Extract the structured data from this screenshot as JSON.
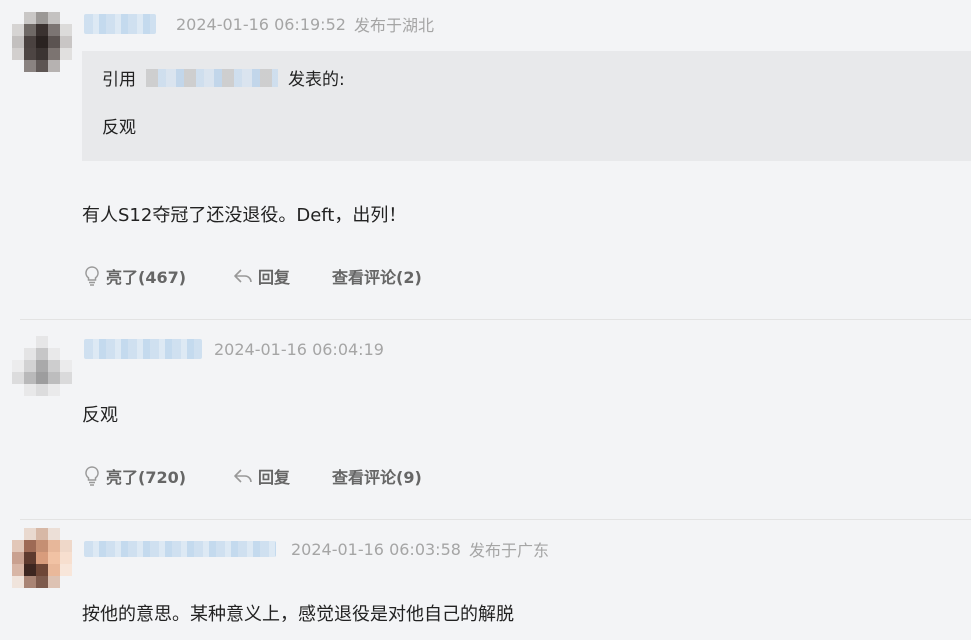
{
  "comments": [
    {
      "timestamp": "2024-01-16 06:19:52",
      "location": "发布于湖北",
      "quote": {
        "prefix": "引用",
        "suffix": "发表的:",
        "text": "反观"
      },
      "body": "有人S12夺冠了还没退役。Deft，出列！",
      "actions": {
        "like": "亮了(467)",
        "reply": "回复",
        "view": "查看评论(2)"
      }
    },
    {
      "timestamp": "2024-01-16 06:04:19",
      "location": "",
      "body": "反观",
      "actions": {
        "like": "亮了(720)",
        "reply": "回复",
        "view": "查看评论(9)"
      }
    },
    {
      "timestamp": "2024-01-16 06:03:58",
      "location": "发布于广东",
      "body": "按他的意思。某种意义上，感觉退役是对他自己的解脱"
    }
  ],
  "icons": {
    "like": "lightbulb-icon",
    "reply": "reply-arrow-icon"
  },
  "colors": {
    "background": "#f3f4f6",
    "meta": "#a5a5a5",
    "action": "#666666",
    "quote_bg": "#e8e9eb"
  }
}
